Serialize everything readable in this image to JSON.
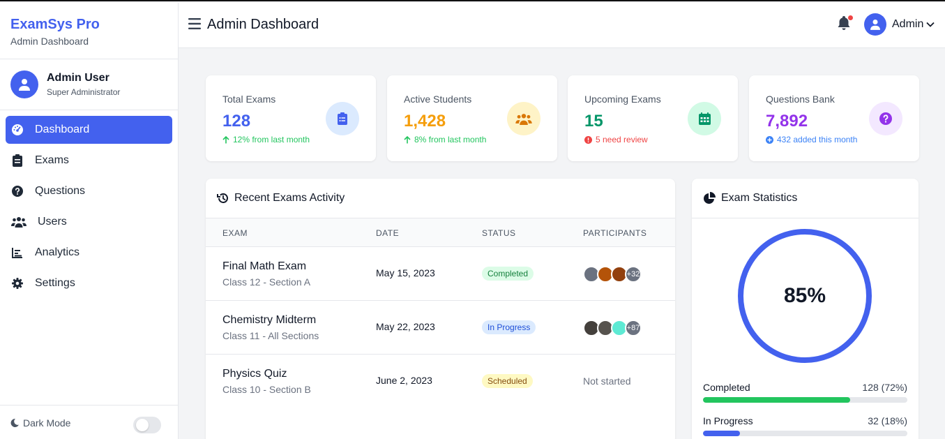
{
  "brand": {
    "title": "ExamSys Pro",
    "subtitle": "Admin Dashboard"
  },
  "profile": {
    "name": "Admin User",
    "role": "Super Administrator"
  },
  "nav": [
    {
      "label": "Dashboard",
      "icon": "dashboard-gauge-icon",
      "active": true
    },
    {
      "label": "Exams",
      "icon": "clipboard-icon"
    },
    {
      "label": "Questions",
      "icon": "question-circle-icon"
    },
    {
      "label": "Users",
      "icon": "users-icon"
    },
    {
      "label": "Analytics",
      "icon": "bar-chart-icon"
    },
    {
      "label": "Settings",
      "icon": "gear-icon"
    }
  ],
  "footer": {
    "dark_mode_label": "Dark Mode",
    "dark_mode_on": false
  },
  "header": {
    "title": "Admin Dashboard",
    "user_label": "Admin"
  },
  "stats": [
    {
      "label": "Total Exams",
      "value": "128",
      "sub": "12% from last month",
      "color": "#4361ee",
      "sub_color": "#22c55e",
      "icon": "clipboard-list-icon"
    },
    {
      "label": "Active Students",
      "value": "1,428",
      "sub": "8% from last month",
      "color": "#f59e0b",
      "sub_color": "#22c55e",
      "icon": "users-icon"
    },
    {
      "label": "Upcoming Exams",
      "value": "15",
      "sub": "5 need review",
      "color": "#059669",
      "sub_color": "#ef4444",
      "icon": "calendar-icon"
    },
    {
      "label": "Questions Bank",
      "value": "7,892",
      "sub": "432 added this month",
      "color": "#9333ea",
      "sub_color": "#3b82f6",
      "icon": "question-circle-icon"
    }
  ],
  "recent": {
    "title": "Recent Exams Activity",
    "columns": [
      "EXAM",
      "DATE",
      "STATUS",
      "PARTICIPANTS"
    ],
    "rows": [
      {
        "name": "Final Math Exam",
        "class": "Class 12 - Section A",
        "date": "May 15, 2023",
        "status": "Completed",
        "more": "+32"
      },
      {
        "name": "Chemistry Midterm",
        "class": "Class 11 - All Sections",
        "date": "May 22, 2023",
        "status": "In Progress",
        "more": "+87"
      },
      {
        "name": "Physics Quiz",
        "class": "Class 10 - Section B",
        "date": "June 2, 2023",
        "status": "Scheduled",
        "participants_text": "Not started"
      }
    ]
  },
  "exam_stats": {
    "title": "Exam Statistics",
    "percent": "85%",
    "bars": [
      {
        "label": "Completed",
        "value": "128 (72%)",
        "fraction": 0.72,
        "color": "#22c55e"
      },
      {
        "label": "In Progress",
        "value": "32 (18%)",
        "fraction": 0.18,
        "color": "#4361ee"
      }
    ]
  }
}
